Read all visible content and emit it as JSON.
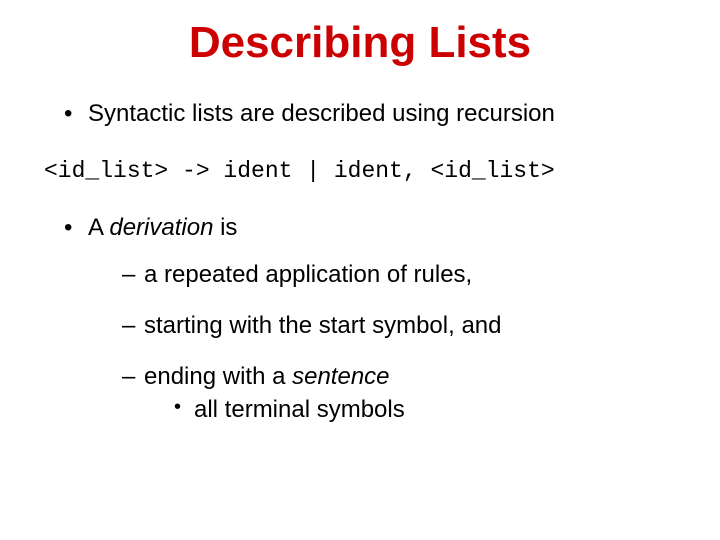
{
  "title": "Describing Lists",
  "bullet1": "Syntactic lists are described using recursion",
  "grammar_rule": "<id_list> -> ident | ident, <id_list>",
  "bullet2_lead": "A ",
  "bullet2_em": "derivation",
  "bullet2_tail": " is",
  "sub1": "a repeated application of rules,",
  "sub2": "starting with the start symbol, and",
  "sub3_lead": "ending with a ",
  "sub3_em": "sentence",
  "sub3_sub": "all terminal symbols"
}
